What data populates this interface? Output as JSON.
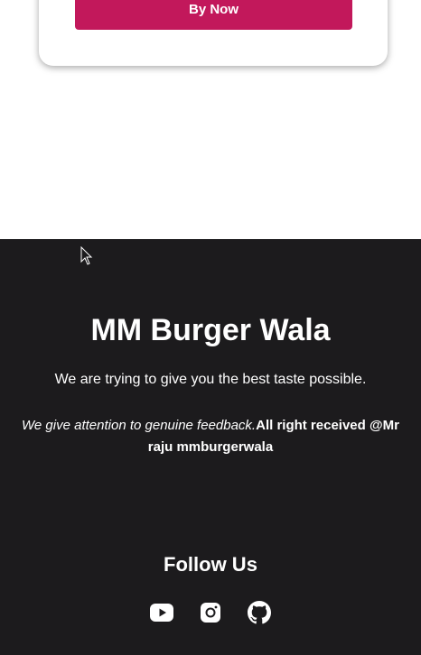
{
  "card": {
    "buy_label": "By Now"
  },
  "footer": {
    "brand": "MM Burger Wala",
    "tagline": "We are trying to give you the best taste possible.",
    "feedback_italic": "We give attention to genuine feedback.",
    "rights": "All right received @Mr raju mmburgerwala",
    "follow_title": "Follow Us",
    "socials": [
      {
        "icon": "youtube-icon"
      },
      {
        "icon": "instagram-icon"
      },
      {
        "icon": "github-icon"
      }
    ]
  },
  "colors": {
    "accent": "#c2185b",
    "footer_bg": "#1c1b1d"
  }
}
